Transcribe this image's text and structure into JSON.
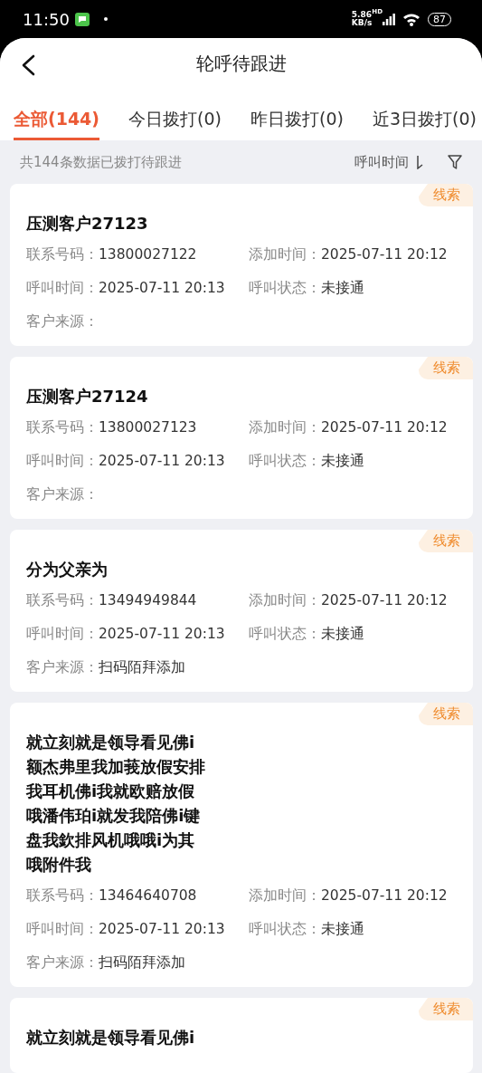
{
  "status_bar": {
    "time": "11:50",
    "speed_value": "5.86",
    "speed_unit": "KB/s",
    "network": "HD",
    "battery": "87"
  },
  "header": {
    "title": "轮呼待跟进"
  },
  "tabs": [
    {
      "label": "全部(144)",
      "selected": true
    },
    {
      "label": "今日拨打(0)",
      "selected": false
    },
    {
      "label": "昨日拨打(0)",
      "selected": false
    },
    {
      "label": "近3日拨打(0)",
      "selected": false
    }
  ],
  "summary": {
    "text": "共144条数据已拨打待跟进",
    "sort_label": "呼叫时间"
  },
  "cards": [
    {
      "tag": "线索",
      "title": "压测客户27123",
      "fields": [
        {
          "label": "联系号码：",
          "value": "13800027122"
        },
        {
          "label": "添加时间：",
          "value": "2025-07-11 20:12"
        },
        {
          "label": "呼叫时间：",
          "value": "2025-07-11 20:13"
        },
        {
          "label": "呼叫状态：",
          "value": "未接通"
        },
        {
          "label": "客户来源："
        }
      ]
    },
    {
      "tag": "线索",
      "title": "压测客户27124",
      "fields": [
        {
          "label": "联系号码：",
          "value": "13800027123"
        },
        {
          "label": "添加时间：",
          "value": "2025-07-11 20:12"
        },
        {
          "label": "呼叫时间：",
          "value": "2025-07-11 20:13"
        },
        {
          "label": "呼叫状态：",
          "value": "未接通"
        },
        {
          "label": "客户来源："
        }
      ]
    },
    {
      "tag": "线索",
      "title": "分为父亲为",
      "fields": [
        {
          "label": "联系号码：",
          "value": "13494949844"
        },
        {
          "label": "添加时间：",
          "value": "2025-07-11 20:12"
        },
        {
          "label": "呼叫时间：",
          "value": "2025-07-11 20:13"
        },
        {
          "label": "呼叫状态：",
          "value": "未接通"
        },
        {
          "label": "客户来源：",
          "value": "扫码陌拜添加"
        }
      ]
    },
    {
      "tag": "线索",
      "title": "就立刻就是领导看见佛i额杰弗里我加莪放假安排我耳机佛i我就欧赔放假哦潘伟珀i就发我陪佛i键盘我欽排风机哦哦i为其哦附件我",
      "fields": [
        {
          "label": "联系号码：",
          "value": "13464640708"
        },
        {
          "label": "添加时间：",
          "value": "2025-07-11 20:12"
        },
        {
          "label": "呼叫时间：",
          "value": "2025-07-11 20:13"
        },
        {
          "label": "呼叫状态：",
          "value": "未接通"
        },
        {
          "label": "客户来源：",
          "value": "扫码陌拜添加"
        }
      ]
    },
    {
      "tag": "线索",
      "title": "就立刻就是领导看见佛i"
    }
  ]
}
